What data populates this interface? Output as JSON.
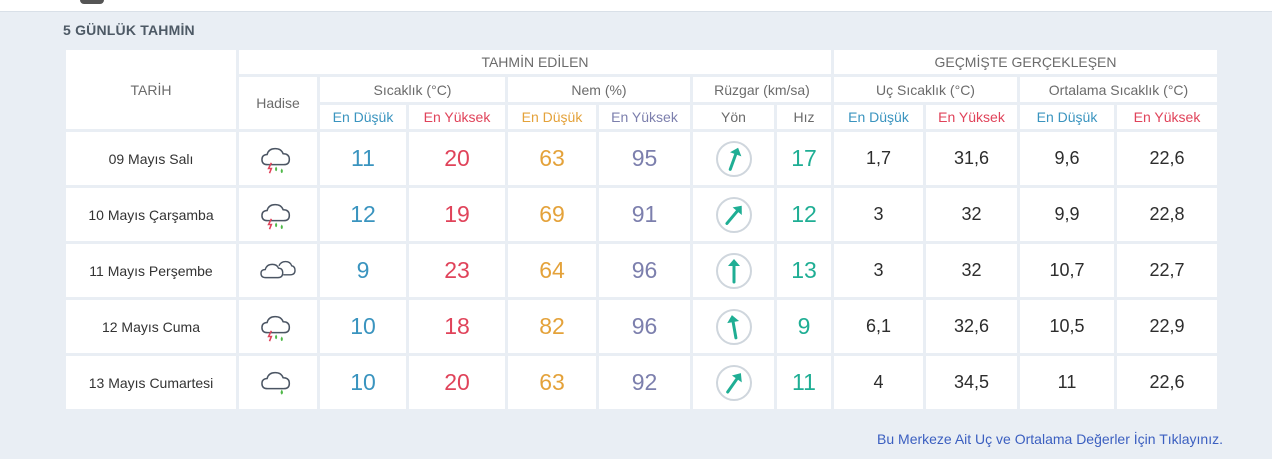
{
  "section_title": "5 GÜNLÜK TAHMİN",
  "headers": {
    "date": "TARİH",
    "forecast": "TAHMİN EDİLEN",
    "past": "GEÇMİŞTE GERÇEKLEŞEN",
    "event": "Hadise",
    "temperature": "Sıcaklık (°C)",
    "humidity": "Nem (%)",
    "wind": "Rüzgar (km/sa)",
    "extreme_temp": "Uç Sıcaklık (°C)",
    "avg_temp": "Ortalama Sıcaklık (°C)",
    "lowest": "En Düşük",
    "highest": "En Yüksek",
    "direction": "Yön",
    "speed": "Hız"
  },
  "colors": {
    "low": "#3a94bf",
    "high": "#e0435a",
    "humidity_low": "#e4a23a",
    "humidity_high": "#7c7fad",
    "wind_speed": "#1fae94"
  },
  "rows": [
    {
      "date": "09 Mayıs Salı",
      "icon": "thunderstorm-rain-icon",
      "t_min": "11",
      "t_max": "20",
      "h_min": "63",
      "h_max": "95",
      "wind_dir_deg": 200,
      "wind_speed": "17",
      "uc_min": "1,7",
      "uc_max": "31,6",
      "avg_min": "9,6",
      "avg_max": "22,6"
    },
    {
      "date": "10 Mayıs Çarşamba",
      "icon": "thunderstorm-rain-icon",
      "t_min": "12",
      "t_max": "19",
      "h_min": "69",
      "h_max": "91",
      "wind_dir_deg": 220,
      "wind_speed": "12",
      "uc_min": "3",
      "uc_max": "32",
      "avg_min": "9,9",
      "avg_max": "22,8"
    },
    {
      "date": "11 Mayıs Perşembe",
      "icon": "cloudy-icon",
      "t_min": "9",
      "t_max": "23",
      "h_min": "64",
      "h_max": "96",
      "wind_dir_deg": 180,
      "wind_speed": "13",
      "uc_min": "3",
      "uc_max": "32",
      "avg_min": "10,7",
      "avg_max": "22,7"
    },
    {
      "date": "12 Mayıs Cuma",
      "icon": "thunderstorm-rain-icon",
      "t_min": "10",
      "t_max": "18",
      "h_min": "82",
      "h_max": "96",
      "wind_dir_deg": 170,
      "wind_speed": "9",
      "uc_min": "6,1",
      "uc_max": "32,6",
      "avg_min": "10,5",
      "avg_max": "22,9"
    },
    {
      "date": "13 Mayıs Cumartesi",
      "icon": "cloud-rain-icon",
      "t_min": "10",
      "t_max": "20",
      "h_min": "63",
      "h_max": "92",
      "wind_dir_deg": 215,
      "wind_speed": "11",
      "uc_min": "4",
      "uc_max": "34,5",
      "avg_min": "11",
      "avg_max": "22,6"
    }
  ],
  "footer_link": "Bu Merkeze Ait Uç ve Ortalama Değerler İçin Tıklayınız."
}
